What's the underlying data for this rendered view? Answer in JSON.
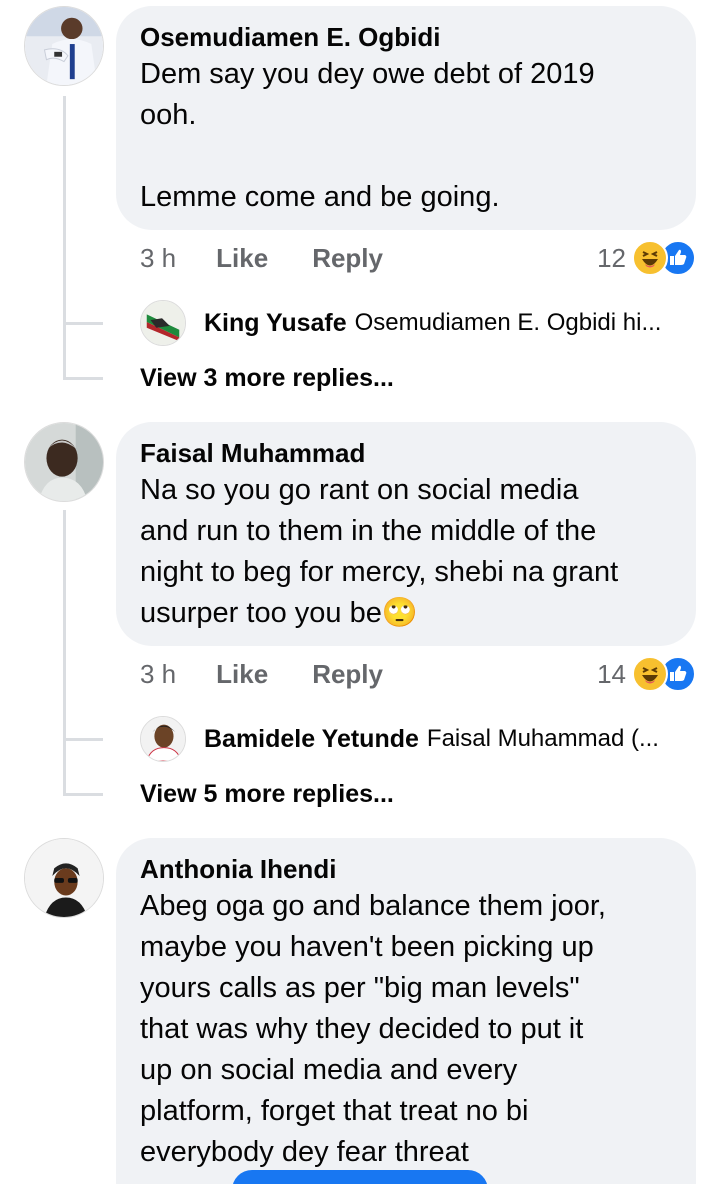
{
  "comments": [
    {
      "author": "Osemudiamen E. Ogbidi",
      "text": "Dem say you dey owe debt of 2019\nooh.\n\nLemme come and be going.",
      "time": "3 h",
      "like_label": "Like",
      "reply_label": "Reply",
      "reaction_count": "12",
      "reply_preview": {
        "author": "King Yusafe",
        "snippet": "Osemudiamen E. Ogbidi hi..."
      },
      "view_more": "View 3 more replies..."
    },
    {
      "author": "Faisal Muhammad",
      "text": "Na so you go rant on social media\nand run to them in the middle of the\nnight to beg for mercy, shebi na grant\nusurper too you be🙄",
      "time": "3 h",
      "like_label": "Like",
      "reply_label": "Reply",
      "reaction_count": "14",
      "reply_preview": {
        "author": "Bamidele Yetunde",
        "snippet": "Faisal Muhammad (..."
      },
      "view_more": "View 5 more replies..."
    },
    {
      "author": "Anthonia Ihendi",
      "text": "Abeg oga go and balance them joor,\nmaybe you haven't been picking up\nyours calls as per \"big man levels\"\nthat was why they decided to put it\nup on social media and every\nplatform, forget that treat no bi\neverybody dey fear threat"
    }
  ],
  "icons": {
    "haha": "haha-reaction-icon",
    "like": "like-reaction-icon"
  },
  "colors": {
    "bubble": "#f0f2f5",
    "meta": "#65676b",
    "brand": "#1877f2",
    "haha": "#f7c02f"
  }
}
